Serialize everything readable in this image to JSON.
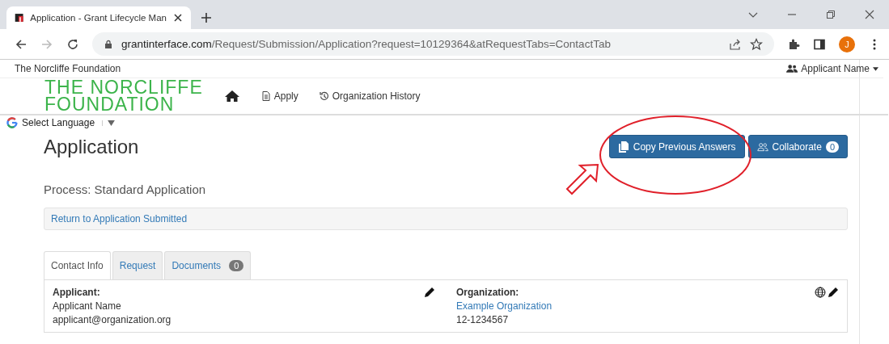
{
  "browser": {
    "tab_title": "Application - Grant Lifecycle Man",
    "url_domain": "grantinterface.com",
    "url_path": "/Request/Submission/Application?request=10129364&atRequestTabs=ContactTab",
    "profile_initial": "J"
  },
  "site": {
    "org_name": "The Norcliffe Foundation",
    "user": "Applicant Name",
    "logo_lines": [
      "THE NORCLIFFE",
      "FOUNDATION"
    ],
    "nav": [
      {
        "kind": "home"
      },
      {
        "kind": "file",
        "label": "Apply"
      },
      {
        "kind": "history",
        "label": "Organization History"
      }
    ],
    "language": "Select Language"
  },
  "page": {
    "title": "Application",
    "process": "Process: Standard Application",
    "return_link": "Return to Application Submitted",
    "copy_button": "Copy Previous Answers",
    "collaborate_button": "Collaborate",
    "collaborate_count": "0"
  },
  "tabs": [
    {
      "label": "Contact Info",
      "selected": true
    },
    {
      "label": "Request",
      "selected": false
    },
    {
      "label": "Documents",
      "selected": false,
      "count": "0"
    }
  ],
  "applicant": {
    "heading": "Applicant:",
    "name": "Applicant Name",
    "email": "applicant@organization.org"
  },
  "organization": {
    "heading": "Organization:",
    "name": "Example Organization",
    "id": "12-1234567"
  }
}
